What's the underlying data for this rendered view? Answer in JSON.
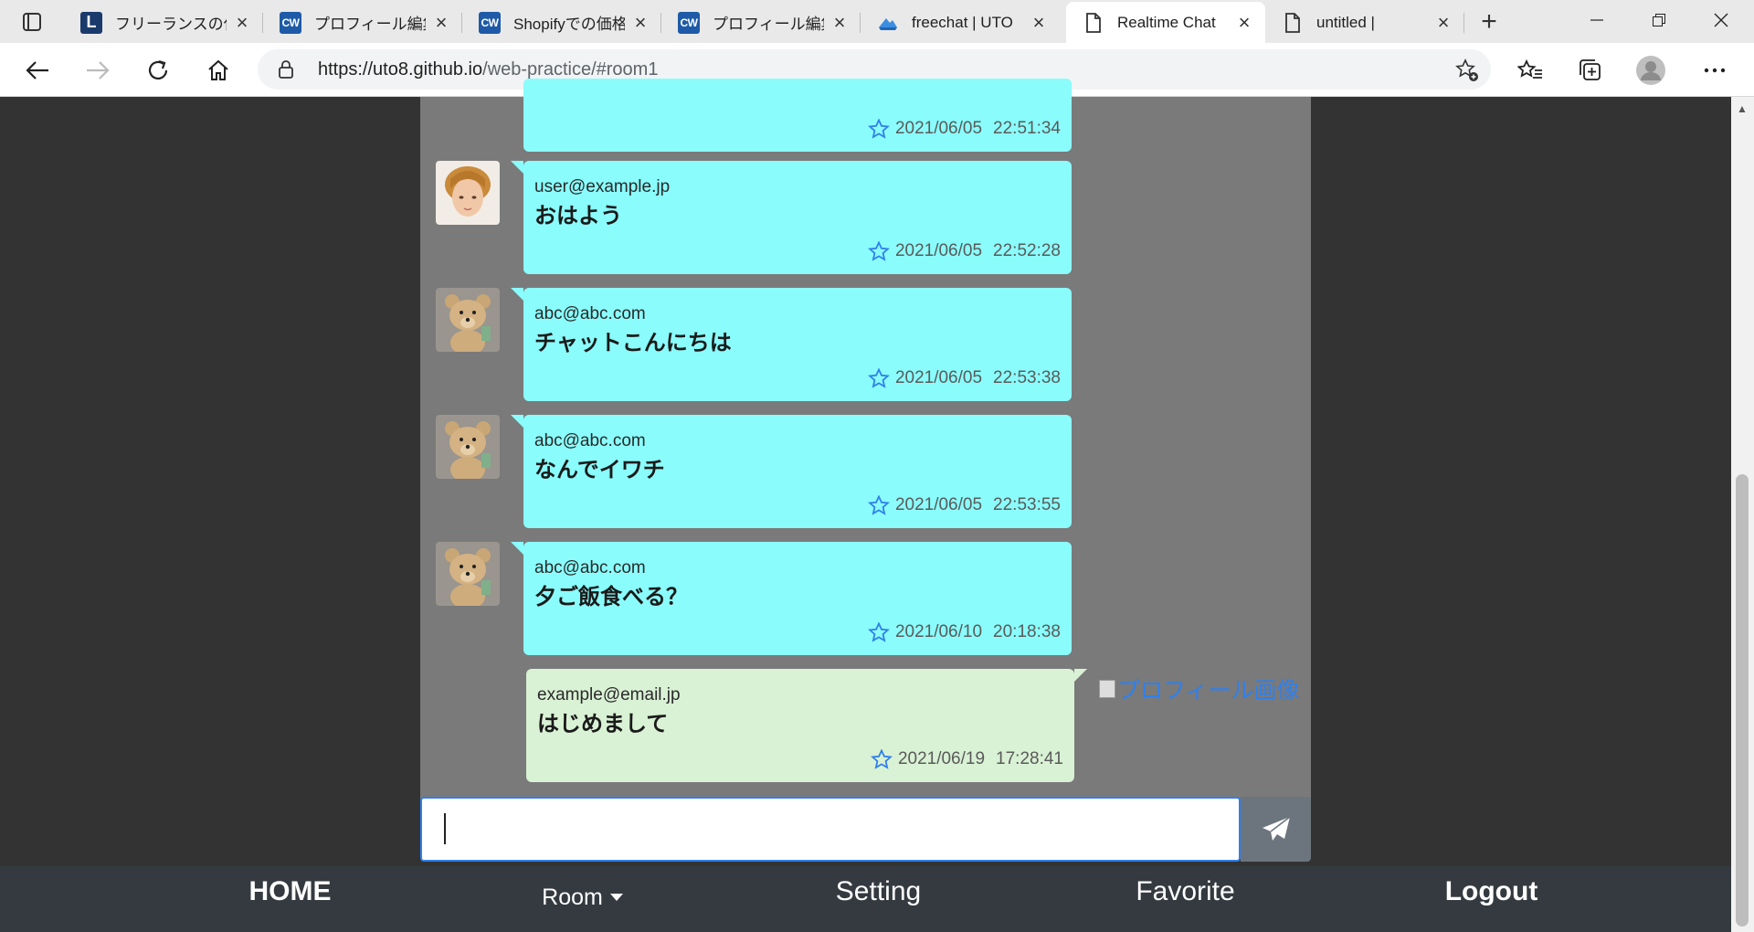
{
  "browser": {
    "tabs": [
      {
        "title": "フリーランスの仕事",
        "favicon": "L"
      },
      {
        "title": "プロフィール編集 |",
        "favicon": "CW"
      },
      {
        "title": "Shopifyでの価格",
        "favicon": "CW"
      },
      {
        "title": "プロフィール編集 |",
        "favicon": "CW"
      },
      {
        "title": "freechat | UTO",
        "favicon": "cloud-icon"
      },
      {
        "title": "Realtime Chat",
        "favicon": "page-icon"
      },
      {
        "title": "untitled |",
        "favicon": "page-icon"
      }
    ],
    "url_host": "https://uto8.github.io",
    "url_path": "/web-practice/#room1"
  },
  "chat": {
    "messages": [
      {
        "user": "user@example.jp",
        "text": "おはよう",
        "date": "2021/06/05",
        "time": "22:52:28"
      },
      {
        "user": "abc@abc.com",
        "text": "チャットこんにちは",
        "date": "2021/06/05",
        "time": "22:53:38"
      },
      {
        "user": "abc@abc.com",
        "text": "なんでイワチ",
        "date": "2021/06/05",
        "time": "22:53:55"
      },
      {
        "user": "abc@abc.com",
        "text": "夕ご飯食べる？",
        "date": "2021/06/10",
        "time": "20:18:38"
      }
    ],
    "partial_message": {
      "date": "2021/06/05",
      "time": "22:51:34"
    },
    "my_message": {
      "user": "example@email.jp",
      "text": "はじめまして",
      "date": "2021/06/19",
      "time": "17:28:41"
    },
    "profile_image_alt": "プロフィール画像"
  },
  "input": {
    "placeholder": ""
  },
  "nav": {
    "home": "HOME",
    "room": "Room",
    "setting": "Setting",
    "favorite": "Favorite",
    "logout": "Logout"
  },
  "colors": {
    "bubble_other": "#8afcfc",
    "bubble_mine": "#d9f1d4",
    "chat_bg": "#7a7a7a",
    "nav_bg": "#343a40",
    "accent": "#2f80ed"
  }
}
